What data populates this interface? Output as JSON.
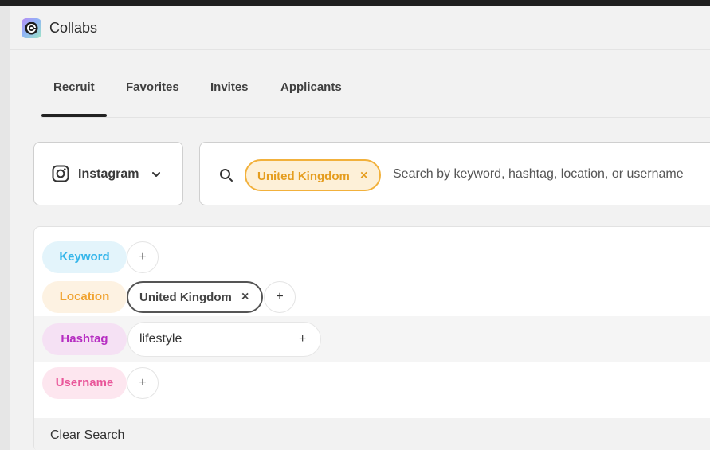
{
  "app": {
    "title": "Collabs"
  },
  "tabs": [
    {
      "label": "Recruit",
      "active": true
    },
    {
      "label": "Favorites",
      "active": false
    },
    {
      "label": "Invites",
      "active": false
    },
    {
      "label": "Applicants",
      "active": false
    }
  ],
  "platform": {
    "selected": "Instagram",
    "icon": "instagram-icon"
  },
  "search": {
    "chips": [
      {
        "label": "United Kingdom",
        "remove": "×"
      }
    ],
    "placeholder": "Search by keyword, hashtag, location, or username"
  },
  "filters": {
    "keyword": {
      "label": "Keyword",
      "add": "+"
    },
    "location": {
      "label": "Location",
      "values": [
        "United Kingdom"
      ],
      "remove": "×",
      "add": "+"
    },
    "hashtag": {
      "label": "Hashtag",
      "input_value": "lifestyle",
      "add": "+"
    },
    "username": {
      "label": "Username",
      "add": "+"
    },
    "clear_label": "Clear Search"
  },
  "colors": {
    "keyword_bg": "#e3f4fb",
    "keyword_fg": "#35b6ea",
    "location_bg": "#fdf2e2",
    "location_fg": "#f0a330",
    "hashtag_bg": "#f5e1f4",
    "hashtag_fg": "#b62ec2",
    "username_bg": "#fde6ef",
    "username_fg": "#e9579a",
    "chip_accent": "#f2b13c"
  }
}
